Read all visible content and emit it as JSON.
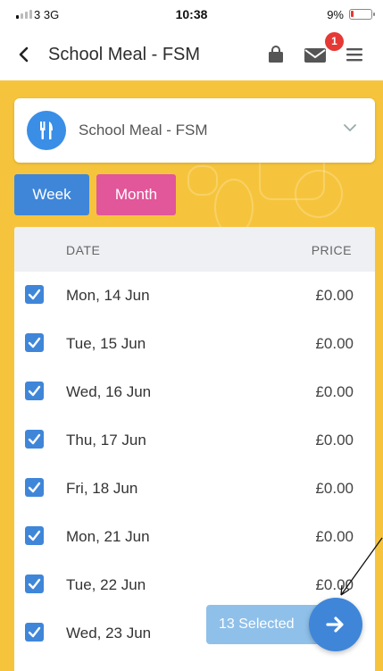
{
  "status_bar": {
    "carrier": "3  3G",
    "time": "10:38",
    "battery": "9%"
  },
  "header": {
    "title": "School Meal - FSM",
    "mail_badge_count": "1"
  },
  "meal_selector": {
    "value": "School Meal - FSM"
  },
  "view_toggle": {
    "week_label": "Week",
    "month_label": "Month"
  },
  "table": {
    "columns": {
      "date": "DATE",
      "price": "PRICE"
    },
    "rows": [
      {
        "date": "Mon, 14 Jun",
        "price": "£0.00",
        "checked": true
      },
      {
        "date": "Tue, 15 Jun",
        "price": "£0.00",
        "checked": true
      },
      {
        "date": "Wed, 16 Jun",
        "price": "£0.00",
        "checked": true
      },
      {
        "date": "Thu, 17 Jun",
        "price": "£0.00",
        "checked": true
      },
      {
        "date": "Fri, 18 Jun",
        "price": "£0.00",
        "checked": true
      },
      {
        "date": "Mon, 21 Jun",
        "price": "£0.00",
        "checked": true
      },
      {
        "date": "Tue, 22 Jun",
        "price": "£0.00",
        "checked": true
      },
      {
        "date": "Wed, 23 Jun",
        "price": "",
        "checked": true
      }
    ]
  },
  "selection": {
    "label": "13 Selected"
  },
  "colors": {
    "accent_blue": "#3f86d9",
    "month_pink": "#e2569a",
    "background_yellow": "#f6c43c",
    "badge_red": "#e53935"
  },
  "icons": {
    "back": "chevron-left-icon",
    "bag": "shopping-bag-icon",
    "mail": "mail-icon",
    "menu": "hamburger-menu-icon",
    "meal": "cutlery-icon",
    "next": "arrow-right-icon"
  }
}
